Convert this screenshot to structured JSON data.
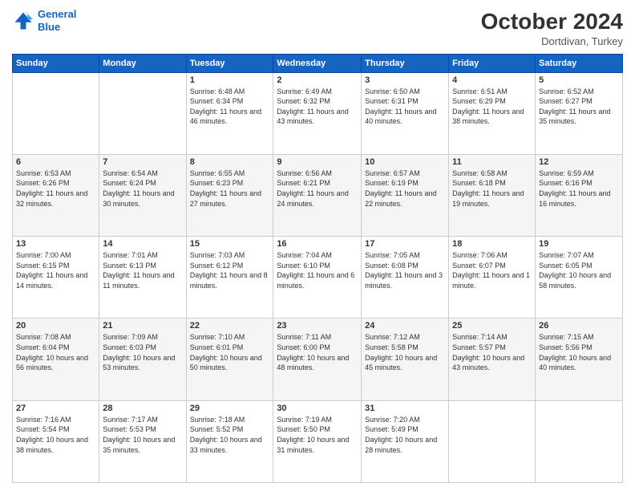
{
  "header": {
    "logo_line1": "General",
    "logo_line2": "Blue",
    "month": "October 2024",
    "location": "Dortdivan, Turkey"
  },
  "weekdays": [
    "Sunday",
    "Monday",
    "Tuesday",
    "Wednesday",
    "Thursday",
    "Friday",
    "Saturday"
  ],
  "weeks": [
    [
      {
        "day": "",
        "sunrise": "",
        "sunset": "",
        "daylight": ""
      },
      {
        "day": "",
        "sunrise": "",
        "sunset": "",
        "daylight": ""
      },
      {
        "day": "1",
        "sunrise": "Sunrise: 6:48 AM",
        "sunset": "Sunset: 6:34 PM",
        "daylight": "Daylight: 11 hours and 46 minutes."
      },
      {
        "day": "2",
        "sunrise": "Sunrise: 6:49 AM",
        "sunset": "Sunset: 6:32 PM",
        "daylight": "Daylight: 11 hours and 43 minutes."
      },
      {
        "day": "3",
        "sunrise": "Sunrise: 6:50 AM",
        "sunset": "Sunset: 6:31 PM",
        "daylight": "Daylight: 11 hours and 40 minutes."
      },
      {
        "day": "4",
        "sunrise": "Sunrise: 6:51 AM",
        "sunset": "Sunset: 6:29 PM",
        "daylight": "Daylight: 11 hours and 38 minutes."
      },
      {
        "day": "5",
        "sunrise": "Sunrise: 6:52 AM",
        "sunset": "Sunset: 6:27 PM",
        "daylight": "Daylight: 11 hours and 35 minutes."
      }
    ],
    [
      {
        "day": "6",
        "sunrise": "Sunrise: 6:53 AM",
        "sunset": "Sunset: 6:26 PM",
        "daylight": "Daylight: 11 hours and 32 minutes."
      },
      {
        "day": "7",
        "sunrise": "Sunrise: 6:54 AM",
        "sunset": "Sunset: 6:24 PM",
        "daylight": "Daylight: 11 hours and 30 minutes."
      },
      {
        "day": "8",
        "sunrise": "Sunrise: 6:55 AM",
        "sunset": "Sunset: 6:23 PM",
        "daylight": "Daylight: 11 hours and 27 minutes."
      },
      {
        "day": "9",
        "sunrise": "Sunrise: 6:56 AM",
        "sunset": "Sunset: 6:21 PM",
        "daylight": "Daylight: 11 hours and 24 minutes."
      },
      {
        "day": "10",
        "sunrise": "Sunrise: 6:57 AM",
        "sunset": "Sunset: 6:19 PM",
        "daylight": "Daylight: 11 hours and 22 minutes."
      },
      {
        "day": "11",
        "sunrise": "Sunrise: 6:58 AM",
        "sunset": "Sunset: 6:18 PM",
        "daylight": "Daylight: 11 hours and 19 minutes."
      },
      {
        "day": "12",
        "sunrise": "Sunrise: 6:59 AM",
        "sunset": "Sunset: 6:16 PM",
        "daylight": "Daylight: 11 hours and 16 minutes."
      }
    ],
    [
      {
        "day": "13",
        "sunrise": "Sunrise: 7:00 AM",
        "sunset": "Sunset: 6:15 PM",
        "daylight": "Daylight: 11 hours and 14 minutes."
      },
      {
        "day": "14",
        "sunrise": "Sunrise: 7:01 AM",
        "sunset": "Sunset: 6:13 PM",
        "daylight": "Daylight: 11 hours and 11 minutes."
      },
      {
        "day": "15",
        "sunrise": "Sunrise: 7:03 AM",
        "sunset": "Sunset: 6:12 PM",
        "daylight": "Daylight: 11 hours and 8 minutes."
      },
      {
        "day": "16",
        "sunrise": "Sunrise: 7:04 AM",
        "sunset": "Sunset: 6:10 PM",
        "daylight": "Daylight: 11 hours and 6 minutes."
      },
      {
        "day": "17",
        "sunrise": "Sunrise: 7:05 AM",
        "sunset": "Sunset: 6:08 PM",
        "daylight": "Daylight: 11 hours and 3 minutes."
      },
      {
        "day": "18",
        "sunrise": "Sunrise: 7:06 AM",
        "sunset": "Sunset: 6:07 PM",
        "daylight": "Daylight: 11 hours and 1 minute."
      },
      {
        "day": "19",
        "sunrise": "Sunrise: 7:07 AM",
        "sunset": "Sunset: 6:05 PM",
        "daylight": "Daylight: 10 hours and 58 minutes."
      }
    ],
    [
      {
        "day": "20",
        "sunrise": "Sunrise: 7:08 AM",
        "sunset": "Sunset: 6:04 PM",
        "daylight": "Daylight: 10 hours and 56 minutes."
      },
      {
        "day": "21",
        "sunrise": "Sunrise: 7:09 AM",
        "sunset": "Sunset: 6:03 PM",
        "daylight": "Daylight: 10 hours and 53 minutes."
      },
      {
        "day": "22",
        "sunrise": "Sunrise: 7:10 AM",
        "sunset": "Sunset: 6:01 PM",
        "daylight": "Daylight: 10 hours and 50 minutes."
      },
      {
        "day": "23",
        "sunrise": "Sunrise: 7:11 AM",
        "sunset": "Sunset: 6:00 PM",
        "daylight": "Daylight: 10 hours and 48 minutes."
      },
      {
        "day": "24",
        "sunrise": "Sunrise: 7:12 AM",
        "sunset": "Sunset: 5:58 PM",
        "daylight": "Daylight: 10 hours and 45 minutes."
      },
      {
        "day": "25",
        "sunrise": "Sunrise: 7:14 AM",
        "sunset": "Sunset: 5:57 PM",
        "daylight": "Daylight: 10 hours and 43 minutes."
      },
      {
        "day": "26",
        "sunrise": "Sunrise: 7:15 AM",
        "sunset": "Sunset: 5:56 PM",
        "daylight": "Daylight: 10 hours and 40 minutes."
      }
    ],
    [
      {
        "day": "27",
        "sunrise": "Sunrise: 7:16 AM",
        "sunset": "Sunset: 5:54 PM",
        "daylight": "Daylight: 10 hours and 38 minutes."
      },
      {
        "day": "28",
        "sunrise": "Sunrise: 7:17 AM",
        "sunset": "Sunset: 5:53 PM",
        "daylight": "Daylight: 10 hours and 35 minutes."
      },
      {
        "day": "29",
        "sunrise": "Sunrise: 7:18 AM",
        "sunset": "Sunset: 5:52 PM",
        "daylight": "Daylight: 10 hours and 33 minutes."
      },
      {
        "day": "30",
        "sunrise": "Sunrise: 7:19 AM",
        "sunset": "Sunset: 5:50 PM",
        "daylight": "Daylight: 10 hours and 31 minutes."
      },
      {
        "day": "31",
        "sunrise": "Sunrise: 7:20 AM",
        "sunset": "Sunset: 5:49 PM",
        "daylight": "Daylight: 10 hours and 28 minutes."
      },
      {
        "day": "",
        "sunrise": "",
        "sunset": "",
        "daylight": ""
      },
      {
        "day": "",
        "sunrise": "",
        "sunset": "",
        "daylight": ""
      }
    ]
  ]
}
